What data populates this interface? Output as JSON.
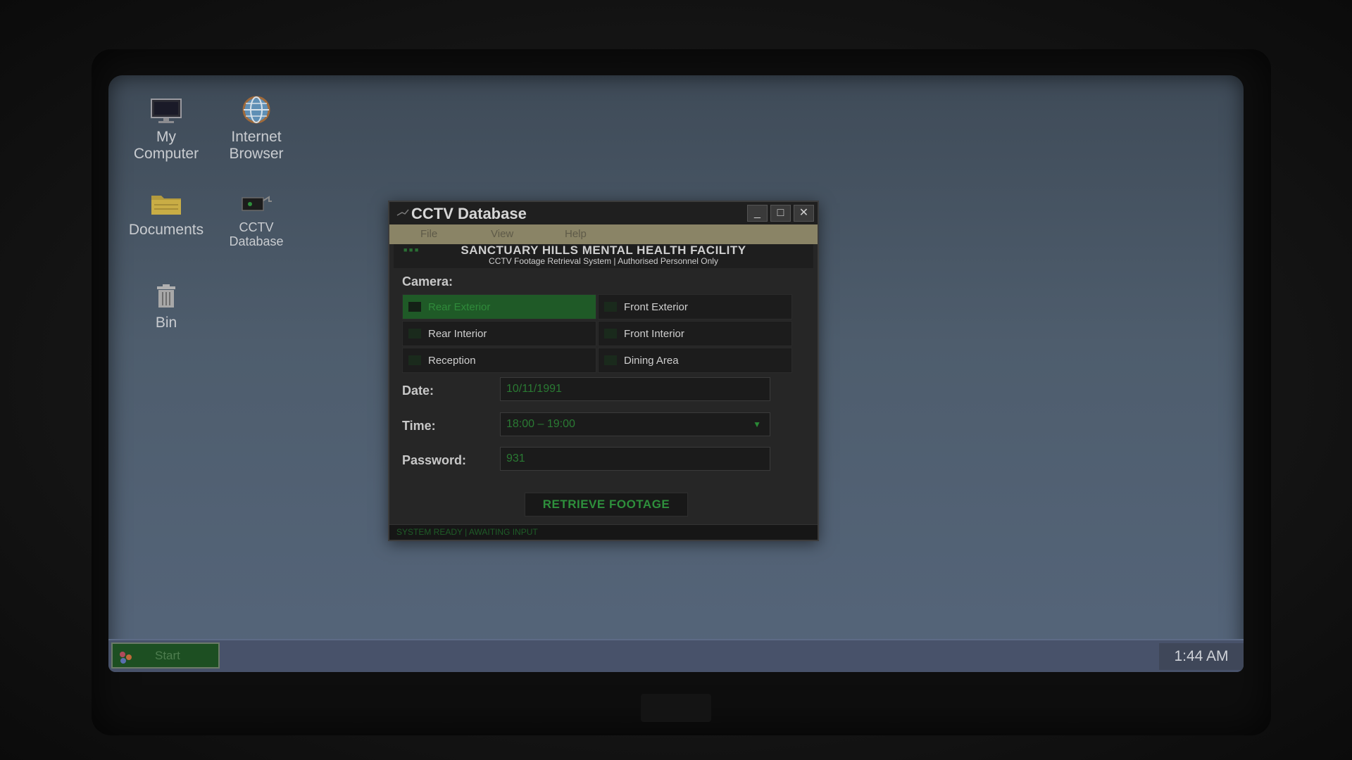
{
  "desktop": {
    "icons": [
      {
        "label_line1": "My",
        "label_line2": "Computer",
        "icon": "monitor-icon"
      },
      {
        "label_line1": "Internet",
        "label_line2": "Browser",
        "icon": "globe-icon"
      },
      {
        "label": "Documents",
        "icon": "folder-icon"
      },
      {
        "label_line1": "CCTV",
        "label_line2": "Database",
        "icon": "cctv-camera-icon"
      },
      {
        "label": "Bin",
        "icon": "trash-bin-icon"
      }
    ]
  },
  "window": {
    "title": "CCTV Database",
    "buttons": {
      "minimize": "_",
      "maximize": "□",
      "close": "✕"
    },
    "menu": [
      "File",
      "View",
      "Help"
    ],
    "banner_title": "SANCTUARY HILLS MENTAL HEALTH FACILITY",
    "banner_subtitle": "CCTV Footage Retrieval System  |  Authorised Personnel Only",
    "camera_label": "Camera:",
    "cameras": [
      {
        "label": "Rear Exterior",
        "selected": true
      },
      {
        "label": "Front Exterior",
        "selected": false
      },
      {
        "label": "Rear Interior",
        "selected": false
      },
      {
        "label": "Front Interior",
        "selected": false
      },
      {
        "label": "Reception",
        "selected": false
      },
      {
        "label": "Dining Area",
        "selected": false
      }
    ],
    "date_label": "Date:",
    "date_value": "10/11/1991",
    "time_label": "Time:",
    "time_value": "18:00 – 19:00",
    "password_label": "Password:",
    "password_value": "931",
    "retrieve_button": "RETRIEVE FOOTAGE",
    "status": "SYSTEM READY  |  AWAITING INPUT"
  },
  "taskbar": {
    "start_label": "Start",
    "clock": "1:44 AM"
  },
  "colors": {
    "accent_green": "#2e8f3c",
    "selected_camera_bg": "#1f5a27",
    "desktop_bg": "#4e5d6d"
  }
}
